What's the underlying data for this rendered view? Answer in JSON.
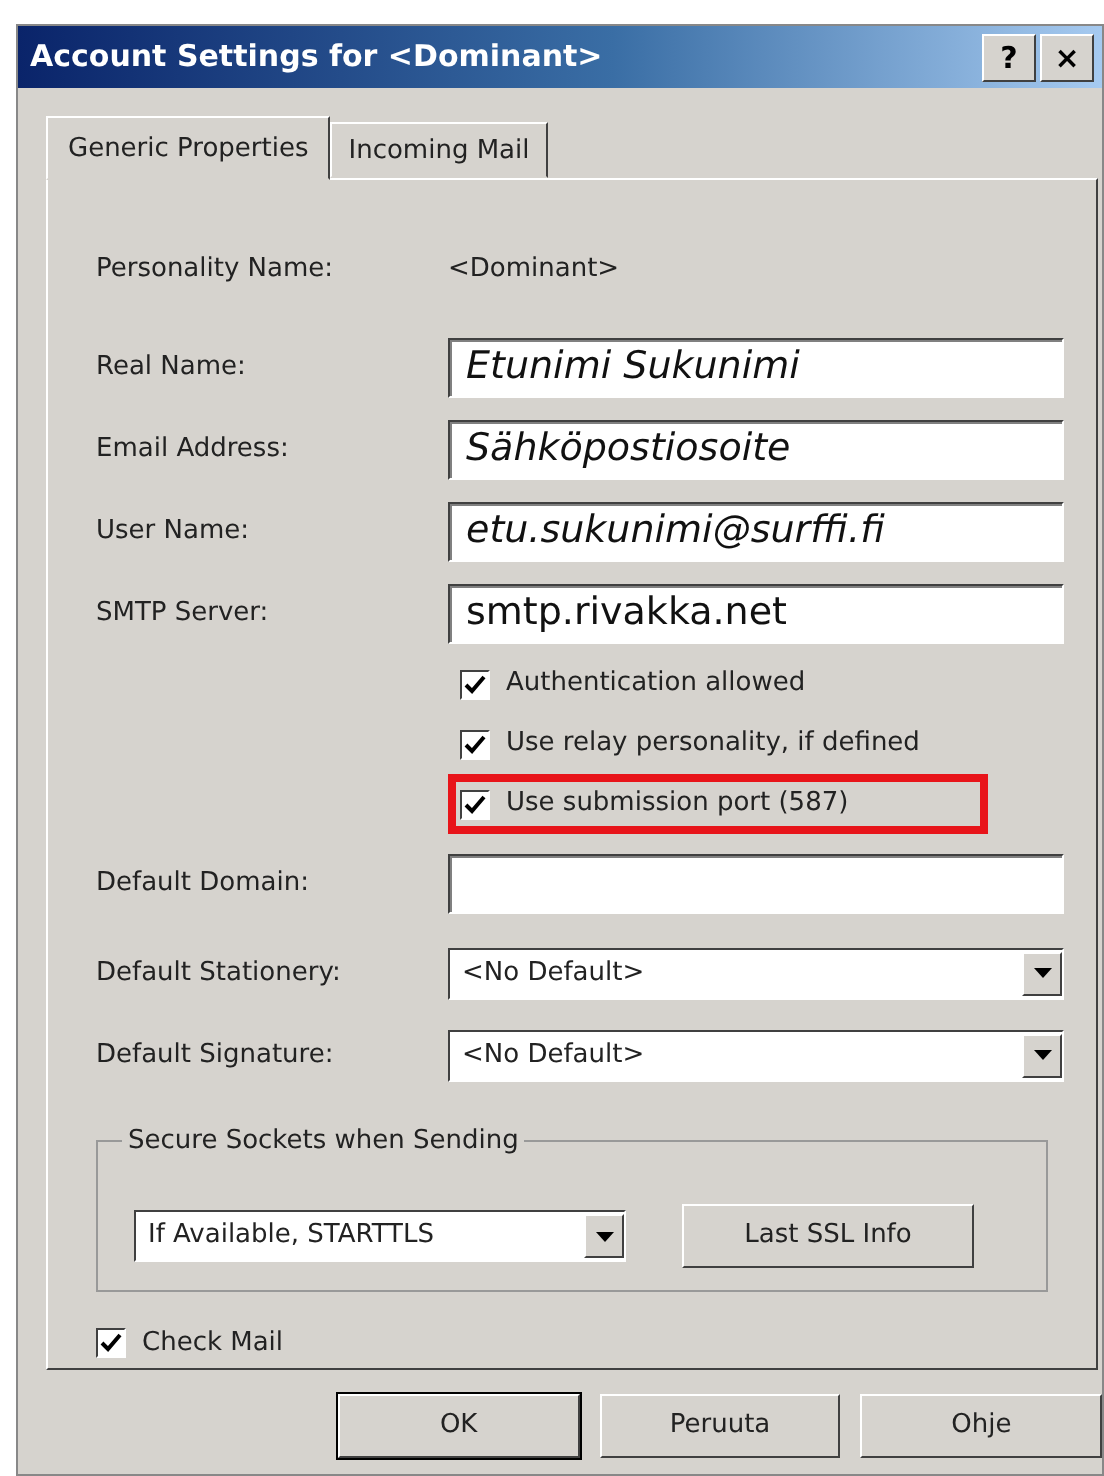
{
  "window": {
    "title": "Account Settings for <Dominant>",
    "title_buttons": [
      "?",
      "×"
    ]
  },
  "tabs": [
    {
      "label": "Generic Properties",
      "selected": true
    },
    {
      "label": "Incoming Mail",
      "selected": false
    }
  ],
  "personality": {
    "label": "Personality Name:",
    "value": "<Dominant>"
  },
  "fields": [
    {
      "label": "Real Name:",
      "value": "Etunimi Sukunimi",
      "italic": true
    },
    {
      "label": "Email Address:",
      "value": "Sähköpostiosoite",
      "italic": true
    },
    {
      "label": "User Name:",
      "value": "etu.sukunimi@surffi.fi",
      "italic": true
    },
    {
      "label": "SMTP Server:",
      "value": "smtp.rivakka.net",
      "italic": false
    }
  ],
  "smtp_options": [
    {
      "label": "Authentication allowed",
      "checked": true,
      "highlighted": false
    },
    {
      "label": "Use relay personality, if defined",
      "checked": true,
      "highlighted": false
    },
    {
      "label": "Use submission port (587)",
      "checked": true,
      "highlighted": true
    }
  ],
  "default_domain": {
    "label": "Default Domain:"
  },
  "dropdowns": [
    {
      "label": "Default Stationery:",
      "value": "<No Default>"
    },
    {
      "label": "Default Signature:",
      "value": "<No Default>"
    }
  ],
  "secure_sockets": {
    "legend": "Secure Sockets when Sending",
    "value": "If Available, STARTTLS",
    "button": "Last SSL Info"
  },
  "check_mail": {
    "label": "Check Mail",
    "checked": true
  },
  "buttons": [
    {
      "label": "OK",
      "default": true
    },
    {
      "label": "Peruuta",
      "default": false
    },
    {
      "label": "Ohje",
      "default": false
    }
  ]
}
